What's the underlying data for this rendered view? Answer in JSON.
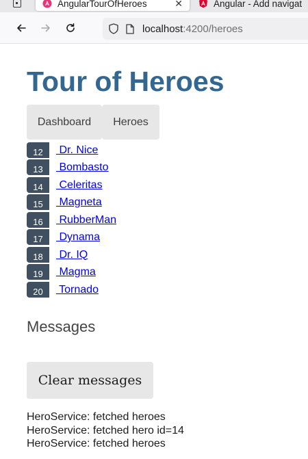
{
  "browser": {
    "tabs": [
      {
        "title": "AngularTourOfHeroes",
        "active": true
      },
      {
        "title": "Angular - Add navigat",
        "active": false
      }
    ],
    "url": {
      "host": "localhost",
      "rest": ":4200/heroes"
    },
    "colors": {
      "accent_title": "#336790",
      "badge_bg": "#405061",
      "link": "#0000ee"
    }
  },
  "app": {
    "title": "Tour of Heroes",
    "nav": {
      "dashboard_label": "Dashboard",
      "heroes_label": "Heroes"
    },
    "heroes": [
      {
        "id": "12",
        "name": " Dr. Nice"
      },
      {
        "id": "13",
        "name": " Bombasto"
      },
      {
        "id": "14",
        "name": " Celeritas"
      },
      {
        "id": "15",
        "name": " Magneta"
      },
      {
        "id": "16",
        "name": " RubberMan"
      },
      {
        "id": "17",
        "name": " Dynama"
      },
      {
        "id": "18",
        "name": " Dr. IQ"
      },
      {
        "id": "19",
        "name": " Magma"
      },
      {
        "id": "20",
        "name": " Tornado"
      }
    ],
    "messages": {
      "title": "Messages",
      "clear_label": "Clear messages",
      "items": [
        "HeroService: fetched heroes",
        "HeroService: fetched hero id=14",
        "HeroService: fetched heroes"
      ]
    }
  }
}
